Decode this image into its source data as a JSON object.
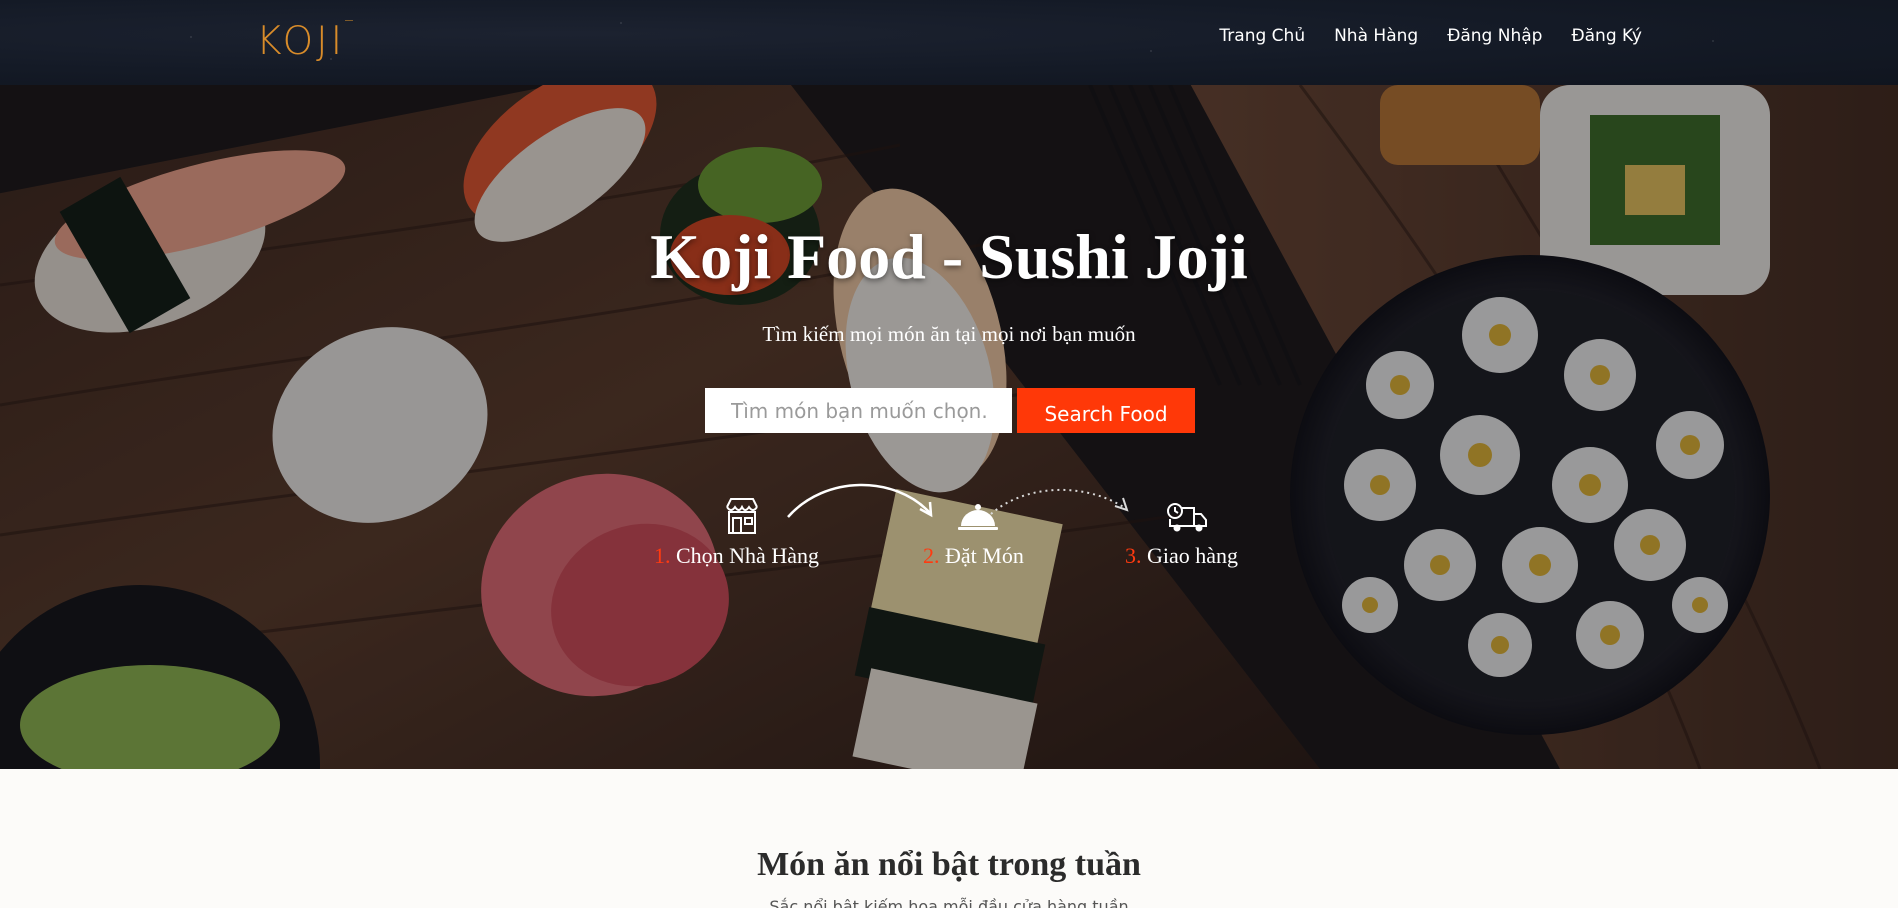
{
  "navbar": {
    "logo": "KOJI",
    "links": [
      "Trang Chủ",
      "Nhà Hàng",
      "Đăng Nhập",
      "Đăng Ký"
    ]
  },
  "hero": {
    "title": "Koji Food - Sushi Joji",
    "subtitle": "Tìm kiếm mọi món ăn tại mọi nơi bạn muốn",
    "search": {
      "placeholder": "Tìm món bạn muốn chọn..",
      "button_label": "Search Food"
    },
    "steps": [
      {
        "number": "1.",
        "label": "Chọn Nhà Hàng",
        "icon": "store-icon"
      },
      {
        "number": "2.",
        "label": "Đặt Món",
        "icon": "cloche-icon"
      },
      {
        "number": "3.",
        "label": "Giao hàng",
        "icon": "delivery-truck-icon"
      }
    ]
  },
  "featured": {
    "title": "Món ăn nổi bật trong tuần",
    "subtitle": "Sắc nổi bật kiếm hoa mỗi đầu cửa hàng tuần"
  },
  "colors": {
    "navbar_bg": "#141a26",
    "logo": "#d98c2a",
    "accent": "#ff3808",
    "step_number": "#ff3a10"
  }
}
